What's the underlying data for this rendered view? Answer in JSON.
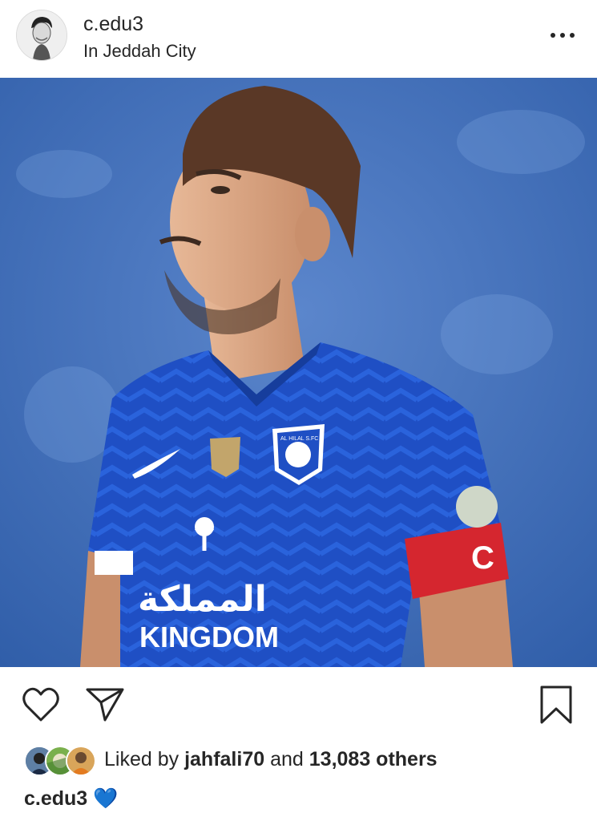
{
  "post": {
    "username": "c.edu3",
    "location": "In Jeddah City",
    "photo": {
      "sponsor_arabic": "المملكة",
      "sponsor_latin": "KINGDOM",
      "club_badge_text": "AL HILAL S.FC",
      "captain_letter": "C"
    },
    "likes": {
      "prefix": "Liked by",
      "first_user": "jahfali70",
      "joiner": "and",
      "others": "13,083 others"
    },
    "caption": {
      "username": "c.edu3",
      "text": "💙"
    }
  },
  "colors": {
    "background": "#ffffff",
    "text": "#262626",
    "jersey_blue": "#1f4fc4",
    "stadium_blue": "#3d6fc0",
    "armband_red": "#d5262f"
  },
  "icons": [
    "more-options-icon",
    "heart-icon",
    "share-icon",
    "bookmark-icon",
    "blue-heart-emoji"
  ]
}
